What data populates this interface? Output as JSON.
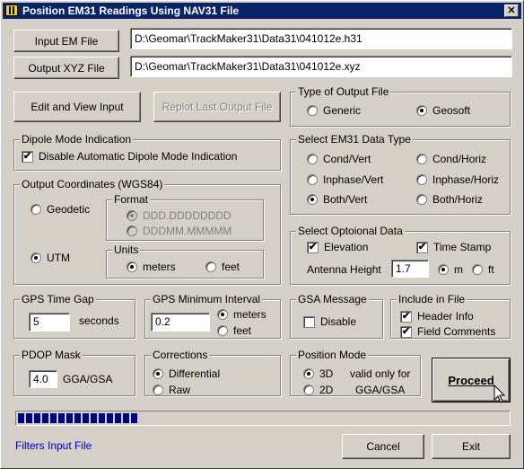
{
  "window": {
    "title": "Position EM31 Readings Using NAV31 File",
    "close": "✕"
  },
  "input_em_file": {
    "button": "Input EM File",
    "path": "D:\\Geomar\\TrackMaker31\\Data31\\041012e.h31"
  },
  "output_xyz_file": {
    "button": "Output XYZ File",
    "path": "D:\\Geomar\\TrackMaker31\\Data31\\041012e.xyz"
  },
  "edit_view_button": "Edit and View Input",
  "replot_button": "Replot Last Output File",
  "type_of_output": {
    "legend": "Type of Output File",
    "options": [
      "Generic",
      "Geosoft"
    ],
    "selected": "Geosoft"
  },
  "dipole_mode": {
    "legend": "Dipole Mode Indication",
    "checkbox": "Disable Automatic Dipole Mode Indication",
    "checked": true
  },
  "output_coords": {
    "legend": "Output Coordinates (WGS84)",
    "geodetic": "Geodetic",
    "utm": "UTM",
    "selected": "UTM",
    "format": {
      "legend": "Format",
      "options": [
        "DDD.DDDDDDDD",
        "DDDMM.MMMMM"
      ],
      "selected": "DDD.DDDDDDDD"
    },
    "units": {
      "legend": "Units",
      "options": [
        "meters",
        "feet"
      ],
      "selected": "meters"
    }
  },
  "data_type": {
    "legend": "Select EM31 Data Type",
    "options": [
      "Cond/Vert",
      "Cond/Horiz",
      "Inphase/Vert",
      "Inphase/Horiz",
      "Both/Vert",
      "Both/Horiz"
    ],
    "selected": "Both/Vert"
  },
  "optional_data": {
    "legend": "Select Optoional Data",
    "elevation": "Elevation",
    "elevation_checked": true,
    "time_stamp": "Time Stamp",
    "time_stamp_checked": true,
    "antenna_label": "Antenna Height",
    "antenna_value": "1.7",
    "unit_options": [
      "m",
      "ft"
    ],
    "unit_selected": "m"
  },
  "gps_time_gap": {
    "legend": "GPS Time Gap",
    "value": "5",
    "unit": "seconds"
  },
  "gps_min_interval": {
    "legend": "GPS Minimum Interval",
    "value": "0.2",
    "options": [
      "meters",
      "feet"
    ],
    "selected": "meters"
  },
  "gsa_message": {
    "legend": "GSA Message",
    "checkbox": "Disable",
    "checked": false
  },
  "include_in_file": {
    "legend": "Include in File",
    "header": "Header Info",
    "header_checked": true,
    "comments": "Field Comments",
    "comments_checked": true
  },
  "pdop_mask": {
    "legend": "PDOP Mask",
    "value": "4.0",
    "unit": "GGA/GSA"
  },
  "corrections": {
    "legend": "Corrections",
    "options": [
      "Differential",
      "Raw"
    ],
    "selected": "Differential"
  },
  "position_mode": {
    "legend": "Position Mode",
    "options": [
      "3D",
      "2D"
    ],
    "selected": "3D",
    "note1": "valid only for",
    "note2": "GGA/GSA"
  },
  "proceed_button": "Proceed",
  "cancel_button": "Cancel",
  "exit_button": "Exit",
  "progress_fraction": 0.25,
  "status_text": "Filters Input File",
  "colors": {
    "title_bar": "#0a246a",
    "progress": "#000080",
    "status": "#0000c0"
  }
}
